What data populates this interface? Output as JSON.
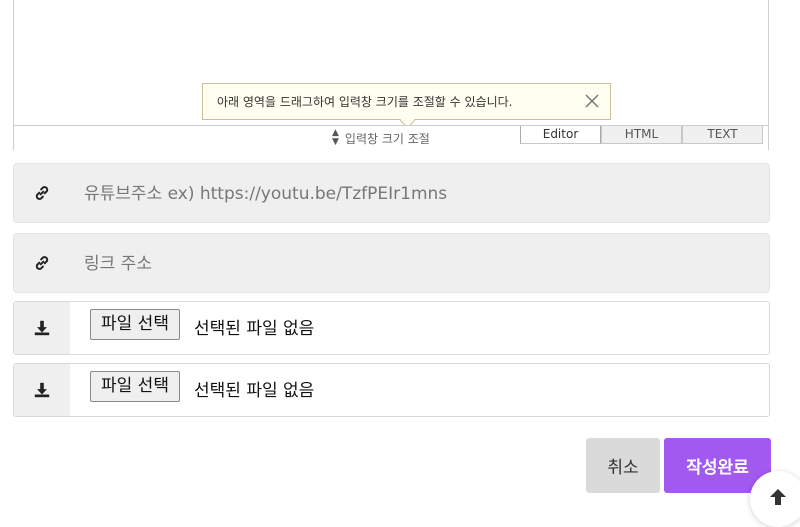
{
  "editor": {
    "tooltip_text": "아래 영역을 드래그하여 입력창 크기를 조절할 수 있습니다.",
    "resize_label": "입력창 크기 조절",
    "modes": [
      "Editor",
      "HTML",
      "TEXT"
    ],
    "active_mode": "Editor"
  },
  "youtube": {
    "icon": "link-icon",
    "placeholder": "유튜브주소 ex) https://youtu.be/TzfPEIr1mns"
  },
  "link": {
    "icon": "link-icon",
    "placeholder": "링크 주소"
  },
  "files": [
    {
      "icon": "download-icon",
      "button_label": "파일 선택",
      "status": "선택된 파일 없음"
    },
    {
      "icon": "download-icon",
      "button_label": "파일 선택",
      "status": "선택된 파일 없음"
    }
  ],
  "actions": {
    "cancel_label": "취소",
    "submit_label": "작성완료"
  },
  "colors": {
    "submit_bg": "#a259f0",
    "cancel_bg": "#dadada",
    "field_bg": "#efefef",
    "tooltip_bg": "#fffef0"
  },
  "scroll_top_icon": "arrow-up-icon"
}
